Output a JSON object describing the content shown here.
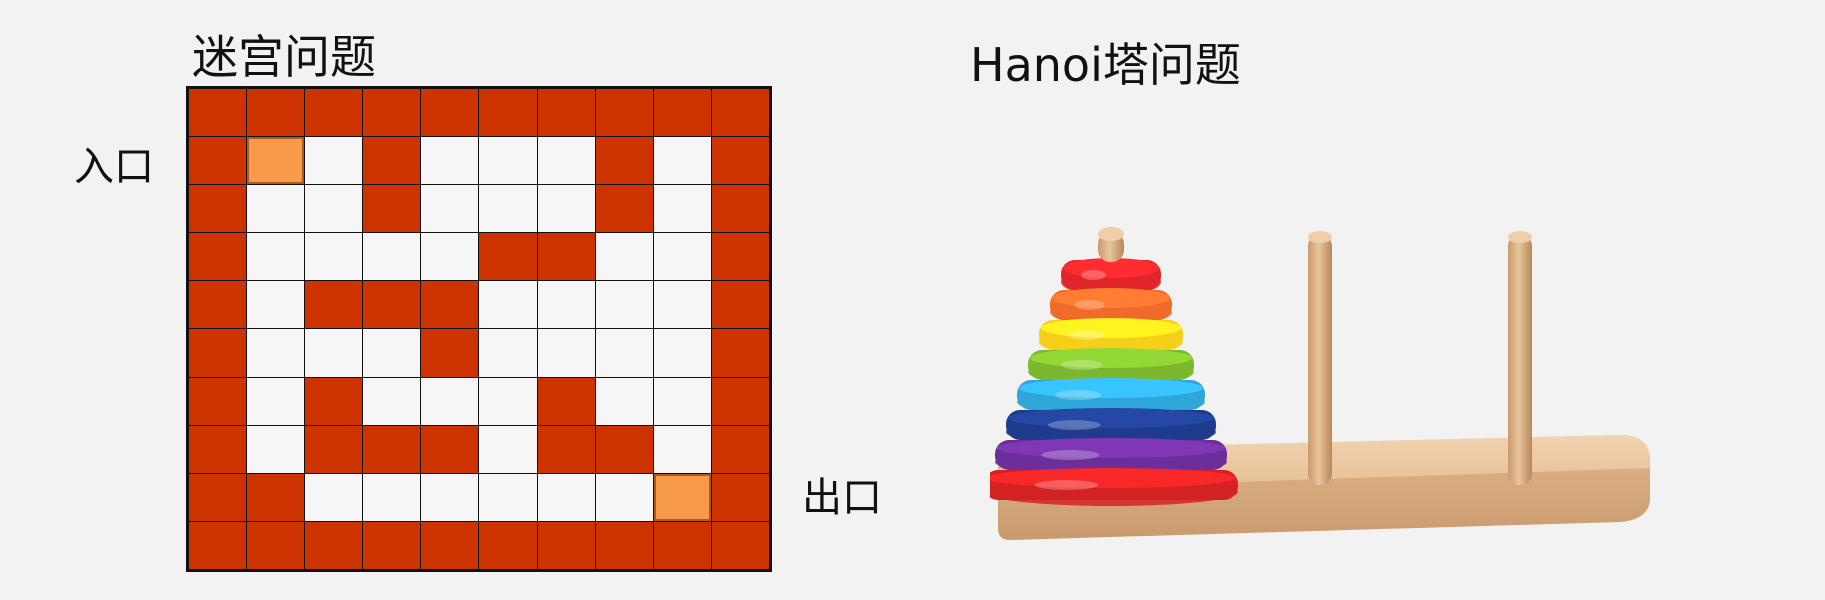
{
  "colors": {
    "background": "#f2f2f2",
    "wall": "#cc3300",
    "path": "#f6f6f6",
    "marker": "#f79a4a",
    "grid_line": "#111111"
  },
  "maze": {
    "title": "迷宫问题",
    "entry_label": "入口",
    "exit_label": "出口",
    "legend": {
      "1": "wall",
      "0": "path",
      "E": "entrance marker",
      "X": "exit marker"
    },
    "grid": [
      [
        "1",
        "1",
        "1",
        "1",
        "1",
        "1",
        "1",
        "1",
        "1",
        "1"
      ],
      [
        "1",
        "E",
        "0",
        "1",
        "0",
        "0",
        "0",
        "1",
        "0",
        "1"
      ],
      [
        "1",
        "0",
        "0",
        "1",
        "0",
        "0",
        "0",
        "1",
        "0",
        "1"
      ],
      [
        "1",
        "0",
        "0",
        "0",
        "0",
        "1",
        "1",
        "0",
        "0",
        "1"
      ],
      [
        "1",
        "0",
        "1",
        "1",
        "1",
        "0",
        "0",
        "0",
        "0",
        "1"
      ],
      [
        "1",
        "0",
        "0",
        "0",
        "1",
        "0",
        "0",
        "0",
        "0",
        "1"
      ],
      [
        "1",
        "0",
        "1",
        "0",
        "0",
        "0",
        "1",
        "0",
        "0",
        "1"
      ],
      [
        "1",
        "0",
        "1",
        "1",
        "1",
        "0",
        "1",
        "1",
        "0",
        "1"
      ],
      [
        "1",
        "1",
        "0",
        "0",
        "0",
        "0",
        "0",
        "0",
        "X",
        "1"
      ],
      [
        "1",
        "1",
        "1",
        "1",
        "1",
        "1",
        "1",
        "1",
        "1",
        "1"
      ]
    ]
  },
  "hanoi": {
    "title": "Hanoi塔问题",
    "image_description_icon": "tower-of-hanoi-toy",
    "rods": 3,
    "disk_colors_top_to_bottom": [
      "#e0262a",
      "#f06a2a",
      "#f6cf1a",
      "#7cb82e",
      "#2fa6d8",
      "#1f3c8c",
      "#6c2f9a",
      "#d32222"
    ],
    "wood_color": "#e8c29a"
  }
}
